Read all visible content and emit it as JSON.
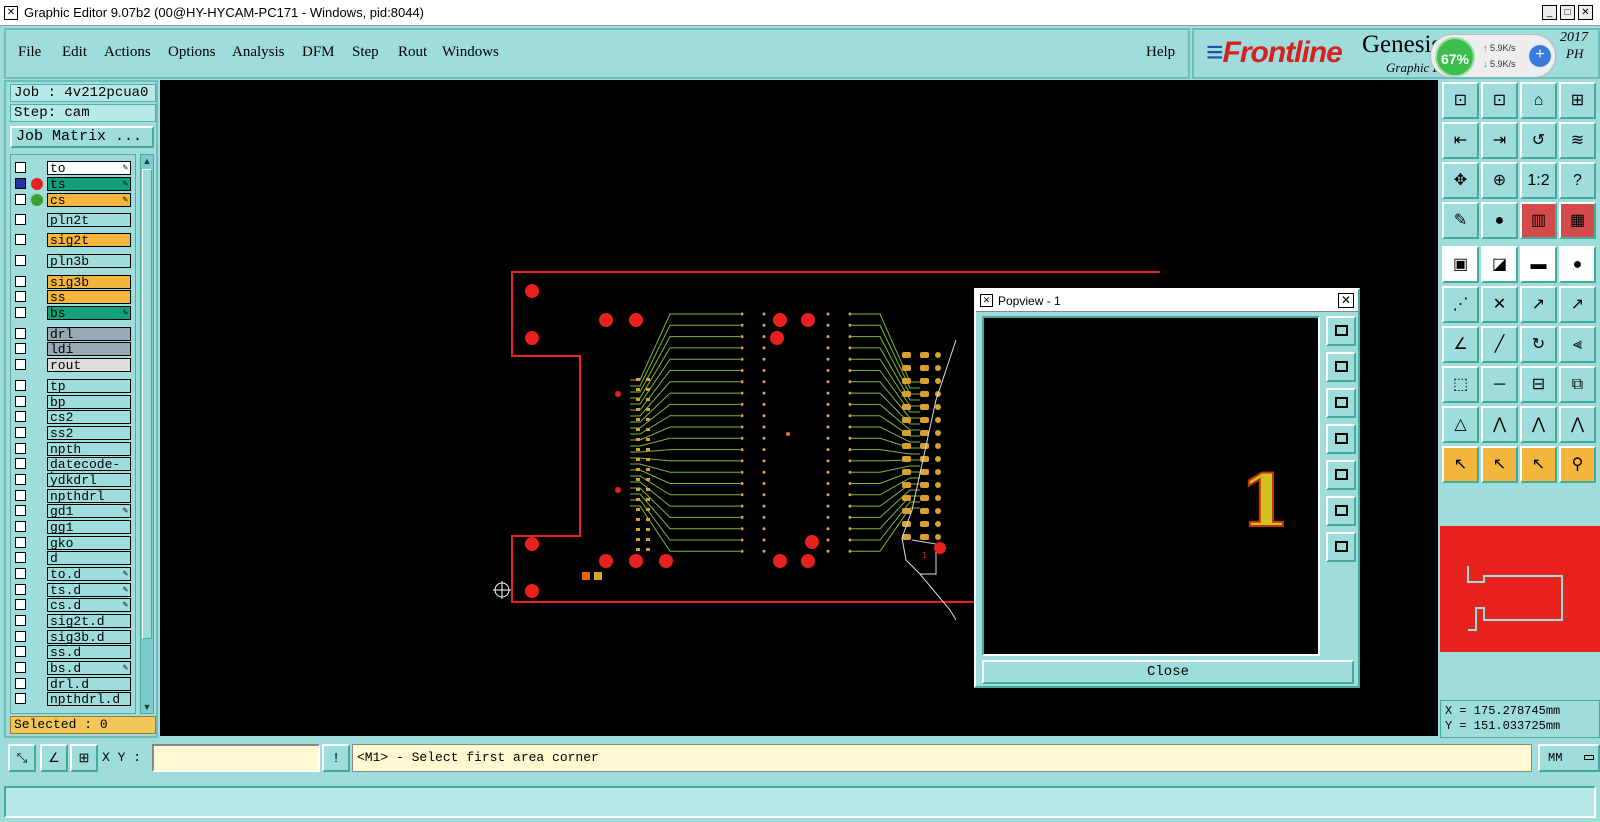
{
  "window": {
    "title": "Graphic Editor 9.07b2 (00@HY-HYCAM-PC171 - Windows, pid:8044)"
  },
  "menu": {
    "items": [
      "File",
      "Edit",
      "Actions",
      "Options",
      "Analysis",
      "DFM",
      "Step",
      "Rout",
      "Windows"
    ],
    "help": "Help"
  },
  "brand": {
    "logo": "Frontline",
    "product": "Genesis",
    "subtitle": "Graphic E",
    "year": "2017",
    "edition": "PH",
    "net_monitor": {
      "percent": "67%",
      "upload": "5.9K/s",
      "download": "5.9K/s"
    }
  },
  "left_panel": {
    "job": "Job : 4v212pcua0",
    "step": "Step: cam",
    "job_matrix_button": "Job Matrix ...",
    "selected": "Selected : 0",
    "layers": [
      {
        "name": "to",
        "color": "#ffffff",
        "pen": true,
        "checked": false,
        "dot": ""
      },
      {
        "name": "ts",
        "color": "#12a07a",
        "pen": true,
        "checked": true,
        "dot": "#e82020"
      },
      {
        "name": "cs",
        "color": "#f3b53c",
        "pen": true,
        "checked": false,
        "dot": "#3aa030"
      },
      {
        "name": "pln2t",
        "color": "#9fdcdc",
        "pen": false,
        "checked": false,
        "dot": ""
      },
      {
        "name": "sig2t",
        "color": "#f3b53c",
        "pen": false,
        "checked": false,
        "dot": ""
      },
      {
        "name": "pln3b",
        "color": "#9fdcdc",
        "pen": false,
        "checked": false,
        "dot": ""
      },
      {
        "name": "sig3b",
        "color": "#f3b53c",
        "pen": false,
        "checked": false,
        "dot": ""
      },
      {
        "name": "ss",
        "color": "#f3b53c",
        "pen": false,
        "checked": false,
        "dot": ""
      },
      {
        "name": "bs",
        "color": "#12a07a",
        "pen": true,
        "checked": false,
        "dot": ""
      },
      {
        "name": "drl",
        "color": "#98a8b4",
        "pen": false,
        "checked": false,
        "dot": ""
      },
      {
        "name": "ldi",
        "color": "#98a8b4",
        "pen": false,
        "checked": false,
        "dot": ""
      },
      {
        "name": "rout",
        "color": "#dddddd",
        "pen": false,
        "checked": false,
        "dot": ""
      },
      {
        "name": "tp",
        "color": "#9fdcdc",
        "pen": false,
        "checked": false,
        "dot": ""
      },
      {
        "name": "bp",
        "color": "#9fdcdc",
        "pen": false,
        "checked": false,
        "dot": ""
      },
      {
        "name": "cs2",
        "color": "#9fdcdc",
        "pen": false,
        "checked": false,
        "dot": ""
      },
      {
        "name": "ss2",
        "color": "#9fdcdc",
        "pen": false,
        "checked": false,
        "dot": ""
      },
      {
        "name": "npth",
        "color": "#9fdcdc",
        "pen": false,
        "checked": false,
        "dot": ""
      },
      {
        "name": "datecode-bs",
        "color": "#9fdcdc",
        "pen": false,
        "checked": false,
        "dot": ""
      },
      {
        "name": "ydkdrl",
        "color": "#9fdcdc",
        "pen": false,
        "checked": false,
        "dot": ""
      },
      {
        "name": "npthdrl",
        "color": "#9fdcdc",
        "pen": false,
        "checked": false,
        "dot": ""
      },
      {
        "name": "gd1",
        "color": "#9fdcdc",
        "pen": true,
        "checked": false,
        "dot": ""
      },
      {
        "name": "gg1",
        "color": "#9fdcdc",
        "pen": false,
        "checked": false,
        "dot": ""
      },
      {
        "name": "gko",
        "color": "#9fdcdc",
        "pen": false,
        "checked": false,
        "dot": ""
      },
      {
        "name": "d",
        "color": "#9fdcdc",
        "pen": false,
        "checked": false,
        "dot": ""
      },
      {
        "name": "to.d",
        "color": "#9fdcdc",
        "pen": true,
        "checked": false,
        "dot": ""
      },
      {
        "name": "ts.d",
        "color": "#9fdcdc",
        "pen": true,
        "checked": false,
        "dot": ""
      },
      {
        "name": "cs.d",
        "color": "#9fdcdc",
        "pen": true,
        "checked": false,
        "dot": ""
      },
      {
        "name": "sig2t.d",
        "color": "#9fdcdc",
        "pen": false,
        "checked": false,
        "dot": ""
      },
      {
        "name": "sig3b.d",
        "color": "#9fdcdc",
        "pen": false,
        "checked": false,
        "dot": ""
      },
      {
        "name": "ss.d",
        "color": "#9fdcdc",
        "pen": false,
        "checked": false,
        "dot": ""
      },
      {
        "name": "bs.d",
        "color": "#9fdcdc",
        "pen": true,
        "checked": false,
        "dot": ""
      },
      {
        "name": "drl.d",
        "color": "#9fdcdc",
        "pen": false,
        "checked": false,
        "dot": ""
      },
      {
        "name": "npthdrl.d",
        "color": "#9fdcdc",
        "pen": false,
        "checked": false,
        "dot": ""
      }
    ]
  },
  "popview": {
    "title": "Popview - 1",
    "number": "1",
    "close_label": "Close"
  },
  "canvas": {
    "pad_label": "1"
  },
  "right_panel": {
    "ratio_label": "1:2",
    "help_glyph": "?",
    "coord_x": "X =  175.278745mm",
    "coord_y": "Y =  151.033725mm"
  },
  "bottom": {
    "xy_label": "X Y :",
    "xy_value": "",
    "message": "<M1> - Select first area corner",
    "units": "MM"
  }
}
